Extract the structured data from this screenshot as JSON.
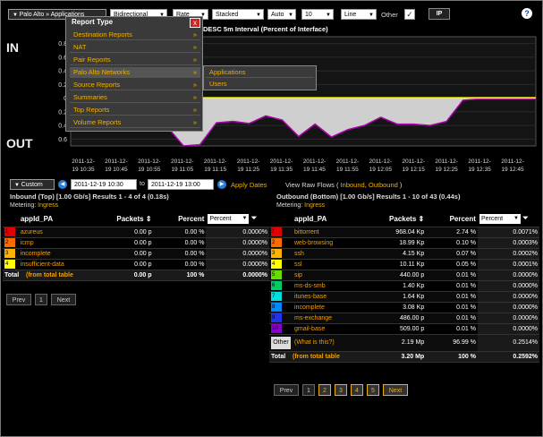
{
  "toolbar": {
    "view_path": "Palo Alto » Applications",
    "direction": "Bidirectional",
    "rate": "Rate",
    "mode": "Stacked",
    "scale": "Auto",
    "count": "10",
    "style": "Line",
    "other_label": "Other",
    "ip_button": "IP",
    "help": "?"
  },
  "chart_title": "DESC  5m Interval (Percent of Interface)",
  "side_labels": {
    "in": "IN",
    "out": "OUT"
  },
  "menu": {
    "title": "Report Type",
    "close": "x",
    "items": [
      {
        "label": "Destination Reports",
        "chev": "»"
      },
      {
        "label": "NAT",
        "chev": "»"
      },
      {
        "label": "Pair Reports",
        "chev": "»"
      },
      {
        "label": "Palo Alto Networks",
        "chev": "»"
      },
      {
        "label": "Source Reports",
        "chev": "»"
      },
      {
        "label": "Summaries",
        "chev": "»"
      },
      {
        "label": "Top Reports",
        "chev": "»"
      },
      {
        "label": "Volume Reports",
        "chev": "»"
      }
    ],
    "submenu": [
      {
        "label": "Applications"
      },
      {
        "label": "Users"
      }
    ]
  },
  "chart_data": {
    "type": "area",
    "y_ticks": [
      "0.8",
      "0.6",
      "0.4",
      "0.2",
      "0",
      "0.2",
      "0.4",
      "0.6"
    ],
    "x_labels": [
      [
        "2011-12-",
        "19 10:35"
      ],
      [
        "2011-12-",
        "19 10:45"
      ],
      [
        "2011-12-",
        "19 10:55"
      ],
      [
        "2011-12-",
        "19 11:05"
      ],
      [
        "2011-12-",
        "19 11:15"
      ],
      [
        "2011-12-",
        "19 11:25"
      ],
      [
        "2011-12-",
        "19 11:35"
      ],
      [
        "2011-12-",
        "19 11:45"
      ],
      [
        "2011-12-",
        "19 11:55"
      ],
      [
        "2011-12-",
        "19 12:05"
      ],
      [
        "2011-12-",
        "19 12:15"
      ],
      [
        "2011-12-",
        "19 12:25"
      ],
      [
        "2011-12-",
        "19 12:35"
      ],
      [
        "2011-12-",
        "19 12:45"
      ]
    ],
    "ylim": [
      -0.7,
      0.9
    ],
    "inbound": {
      "values": [
        0.01,
        0.01,
        0.01,
        0.01,
        0.01,
        0.01,
        0.01,
        0.01,
        0.01,
        0.01,
        0.01,
        0.01,
        0.01,
        0.01,
        0.01,
        0.01,
        0.01,
        0.01,
        0.01,
        0.01,
        0.01,
        0.01,
        0.01,
        0.01,
        0.01,
        0.01,
        0.01,
        0.01
      ]
    },
    "outbound": {
      "values": [
        -0.3,
        -0.4,
        -0.32,
        -0.42,
        -0.32,
        -0.42,
        -0.7,
        -0.68,
        -0.36,
        -0.34,
        -0.37,
        -0.26,
        -0.32,
        -0.56,
        -0.38,
        -0.57,
        -0.46,
        -0.4,
        -0.28,
        -0.38,
        -0.38,
        -0.4,
        -0.34,
        -0.03,
        -0.01,
        -0.01,
        -0.01,
        -0.01
      ]
    }
  },
  "timerange": {
    "custom": "Custom",
    "start": "2011-12-19 10:30",
    "to": "to",
    "end": "2011-12-19 13:00",
    "apply": "Apply Dates",
    "raw_flows": "View Raw Flows (",
    "inbound": "Inbound",
    "comma": ",",
    "outbound": "Outbound",
    "close_paren": ")"
  },
  "inbound_table": {
    "summary": "Inbound (Top) [1.00 Gb/s] Results 1 - 4 of 4 (0.18s)",
    "metering_label": "Metering:",
    "metering_value": "Ingress",
    "headers": {
      "name": "appId_PA",
      "packets": "Packets",
      "percent": "Percent",
      "select": "Percent"
    },
    "rows": [
      {
        "n": "1",
        "color": "#e00000",
        "name": "azureus",
        "packets": "0.00 p",
        "percent": "0.00 %",
        "pct2": "0.0000%"
      },
      {
        "n": "2",
        "color": "#ff6a00",
        "name": "icmp",
        "packets": "0.00 p",
        "percent": "0.00 %",
        "pct2": "0.0000%"
      },
      {
        "n": "3",
        "color": "#ffb300",
        "name": "incomplete",
        "packets": "0.00 p",
        "percent": "0.00 %",
        "pct2": "0.0000%"
      },
      {
        "n": "4",
        "color": "#ffff00",
        "name": "insufficient-data",
        "packets": "0.00 p",
        "percent": "0.00 %",
        "pct2": "0.0000%"
      }
    ],
    "total": {
      "label": "Total",
      "name": "(from total table",
      "packets": "0.00 p",
      "percent": "100 %",
      "pct2": "0.0000%"
    },
    "pager": {
      "prev": "Prev",
      "page": "1",
      "next": "Next"
    }
  },
  "outbound_table": {
    "summary": "Outbound (Bottom) [1.00 Gb/s] Results 1 - 10 of 43 (0.44s)",
    "metering_label": "Metering:",
    "metering_value": "Ingress",
    "headers": {
      "name": "appId_PA",
      "packets": "Packets",
      "percent": "Percent",
      "select": "Percent"
    },
    "rows": [
      {
        "n": "1",
        "color": "#e00000",
        "name": "bittorrent",
        "packets": "968.04 Kp",
        "percent": "2.74 %",
        "pct2": "0.0071%"
      },
      {
        "n": "2",
        "color": "#ff6a00",
        "name": "web-browsing",
        "packets": "18.99 Kp",
        "percent": "0.10 %",
        "pct2": "0.0003%"
      },
      {
        "n": "3",
        "color": "#ffb300",
        "name": "ssh",
        "packets": "4.15 Kp",
        "percent": "0.07 %",
        "pct2": "0.0002%"
      },
      {
        "n": "4",
        "color": "#ffff00",
        "name": "ssl",
        "packets": "10.11 Kp",
        "percent": "0.05 %",
        "pct2": "0.0001%"
      },
      {
        "n": "5",
        "color": "#66dd00",
        "name": "sip",
        "packets": "440.00 p",
        "percent": "0.01 %",
        "pct2": "0.0000%"
      },
      {
        "n": "6",
        "color": "#00cc66",
        "name": "ms-ds-smb",
        "packets": "1.40 Kp",
        "percent": "0.01 %",
        "pct2": "0.0000%"
      },
      {
        "n": "7",
        "color": "#00dddd",
        "name": "itunes-base",
        "packets": "1.64 Kp",
        "percent": "0.01 %",
        "pct2": "0.0000%"
      },
      {
        "n": "8",
        "color": "#0088ff",
        "name": "incomplete",
        "packets": "3.08 Kp",
        "percent": "0.01 %",
        "pct2": "0.0000%"
      },
      {
        "n": "9",
        "color": "#2233ee",
        "name": "ms-exchange",
        "packets": "486.00 p",
        "percent": "0.01 %",
        "pct2": "0.0000%"
      },
      {
        "n": "10",
        "color": "#8800cc",
        "name": "gmail-base",
        "packets": "509.00 p",
        "percent": "0.01 %",
        "pct2": "0.0000%"
      }
    ],
    "other": {
      "label": "Other",
      "name": "(What is this?)",
      "packets": "2.19 Mp",
      "percent": "96.99 %",
      "pct2": "0.2514%"
    },
    "total": {
      "label": "Total",
      "name": "(from total table",
      "packets": "3.20 Mp",
      "percent": "100 %",
      "pct2": "0.2592%"
    },
    "pager": {
      "prev": "Prev",
      "pages": [
        "1",
        "2",
        "3",
        "4",
        "5"
      ],
      "next": "Next"
    }
  }
}
